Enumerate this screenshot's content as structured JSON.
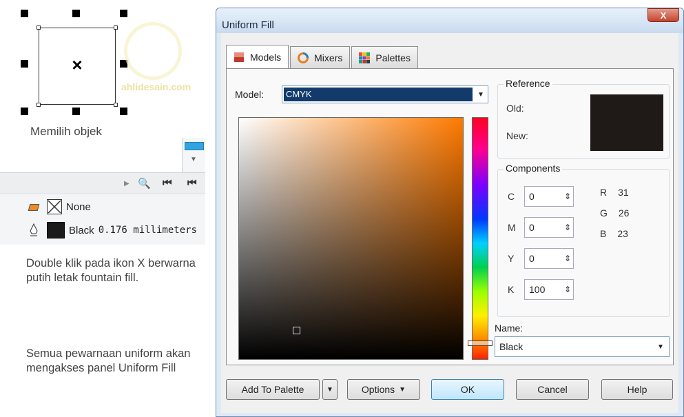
{
  "left_panel": {
    "caption_select": "Memilih objek",
    "watermark": "ahlidesain.com",
    "fill_row": {
      "label": "None"
    },
    "outline_row": {
      "color": "Black",
      "width": "0.176 millimeters"
    },
    "note_1": "Double klik pada ikon X berwarna putih letak fountain fill.",
    "note_2": "Semua pewarnaan uniform akan mengakses panel Uniform Fill"
  },
  "dialog": {
    "title": "Uniform Fill",
    "close_label": "X",
    "tabs": [
      {
        "label": "Models",
        "active": true
      },
      {
        "label": "Mixers",
        "active": false
      },
      {
        "label": "Palettes",
        "active": false
      }
    ],
    "model_label": "Model:",
    "model_value": "CMYK",
    "reference": {
      "title": "Reference",
      "old_label": "Old:",
      "new_label": "New:",
      "color": "#1f1a17"
    },
    "components": {
      "title": "Components",
      "cmyk": [
        {
          "letter": "C",
          "value": "0"
        },
        {
          "letter": "M",
          "value": "0"
        },
        {
          "letter": "Y",
          "value": "0"
        },
        {
          "letter": "K",
          "value": "100"
        }
      ],
      "rgb": [
        {
          "letter": "R",
          "value": "31"
        },
        {
          "letter": "G",
          "value": "26"
        },
        {
          "letter": "B",
          "value": "23"
        }
      ]
    },
    "name_label": "Name:",
    "name_value": "Black",
    "buttons": {
      "add_to_palette": "Add To Palette",
      "options": "Options",
      "ok": "OK",
      "cancel": "Cancel",
      "help": "Help"
    }
  }
}
